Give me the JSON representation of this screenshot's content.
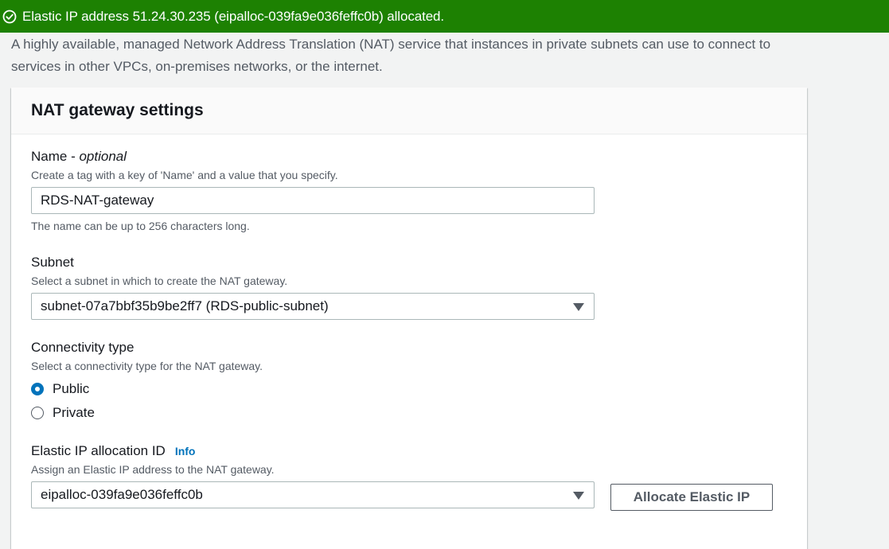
{
  "flash": {
    "icon": "check-circle-icon",
    "message": "Elastic IP address 51.24.30.235 (eipalloc-039fa9e036feffc0b) allocated.",
    "color": "#1d8102"
  },
  "description": "A highly available, managed Network Address Translation (NAT) service that instances in private subnets can use to connect to services in other VPCs, on-premises networks, or the internet.",
  "panel": {
    "title": "NAT gateway settings",
    "name_field": {
      "label": "Name - ",
      "label_optional": "optional",
      "help": "Create a tag with a key of 'Name' and a value that you specify.",
      "value": "RDS-NAT-gateway",
      "constraint": "The name can be up to 256 characters long."
    },
    "subnet_field": {
      "label": "Subnet",
      "help": "Select a subnet in which to create the NAT gateway.",
      "selected": "subnet-07a7bbf35b9be2ff7 (RDS-public-subnet)"
    },
    "connectivity_field": {
      "label": "Connectivity type",
      "help": "Select a connectivity type for the NAT gateway.",
      "options": [
        {
          "label": "Public",
          "selected": true
        },
        {
          "label": "Private",
          "selected": false
        }
      ]
    },
    "eip_field": {
      "label": "Elastic IP allocation ID",
      "info": "Info",
      "help": "Assign an Elastic IP address to the NAT gateway.",
      "selected": "eipalloc-039fa9e036feffc0b",
      "allocate_button": "Allocate Elastic IP"
    }
  },
  "colors": {
    "accent": "#0073bb",
    "success": "#1d8102"
  }
}
